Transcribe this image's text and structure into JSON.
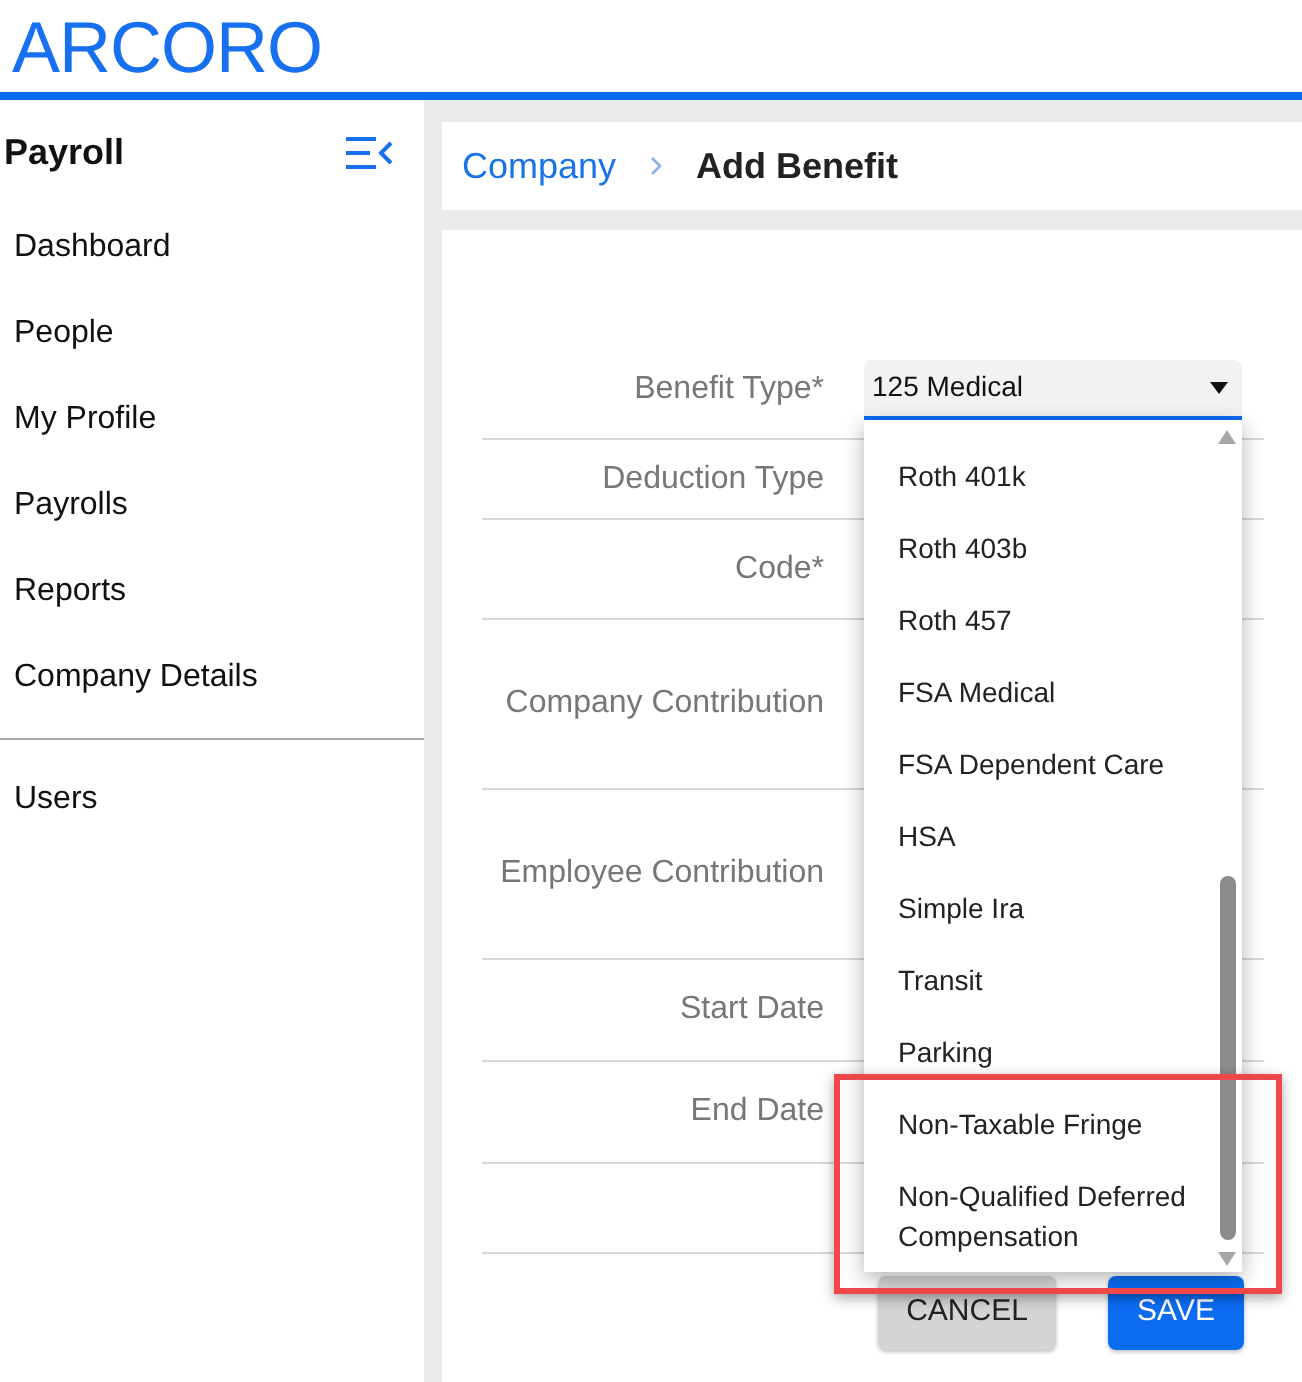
{
  "header": {
    "logo": "ARCORO"
  },
  "sidebar": {
    "title": "Payroll",
    "sections": [
      {
        "items": [
          "Dashboard",
          "People",
          "My Profile",
          "Payrolls",
          "Reports",
          "Company Details"
        ]
      },
      {
        "items": [
          "Users"
        ]
      }
    ]
  },
  "breadcrumb": [
    {
      "label": "Company",
      "kind": "link"
    },
    {
      "label": "Add Benefit",
      "kind": "current"
    }
  ],
  "form": {
    "fields": [
      {
        "label": "Benefit Type*",
        "select": {
          "value": "125 Medical",
          "expanded": true,
          "options": [
            {
              "label": "Roth 401k",
              "highlighted": false
            },
            {
              "label": "Roth 403b",
              "highlighted": false
            },
            {
              "label": "Roth 457",
              "highlighted": false
            },
            {
              "label": "FSA Medical",
              "highlighted": false
            },
            {
              "label": "FSA Dependent Care",
              "highlighted": false
            },
            {
              "label": "HSA",
              "highlighted": false
            },
            {
              "label": "Simple Ira",
              "highlighted": false
            },
            {
              "label": "Transit",
              "highlighted": false
            },
            {
              "label": "Parking",
              "highlighted": false
            },
            {
              "label": "Non-Taxable Fringe",
              "highlighted": true
            },
            {
              "label": "Non-Qualified Deferred Compensation",
              "highlighted": true
            }
          ]
        }
      },
      {
        "label": "Deduction Type"
      },
      {
        "label": "Code*"
      },
      {
        "label": "Company Contribution"
      },
      {
        "label": "Employee Contribution"
      },
      {
        "label": "Start Date"
      },
      {
        "label": "End Date"
      }
    ],
    "buttons": [
      {
        "label": "CANCEL",
        "kind": "secondary"
      },
      {
        "label": "SAVE",
        "kind": "primary"
      }
    ]
  }
}
